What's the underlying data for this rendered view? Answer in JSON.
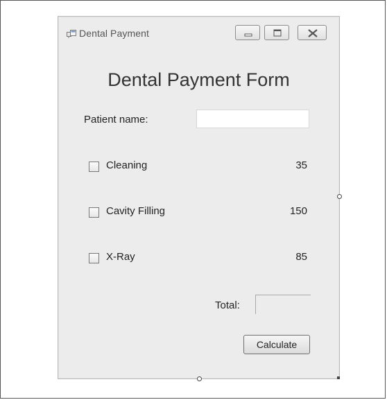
{
  "window": {
    "title": "Dental Payment"
  },
  "form": {
    "heading": "Dental Payment Form",
    "patient_name_label": "Patient name:",
    "patient_name_value": "",
    "services": [
      {
        "label": "Cleaning",
        "price": "35",
        "checked": false
      },
      {
        "label": "Cavity Filling",
        "price": "150",
        "checked": false
      },
      {
        "label": "X-Ray",
        "price": "85",
        "checked": false
      }
    ],
    "total_label": "Total:",
    "total_value": "",
    "calculate_label": "Calculate"
  },
  "colors": {
    "window_bg": "#ececec",
    "text": "#222222"
  }
}
